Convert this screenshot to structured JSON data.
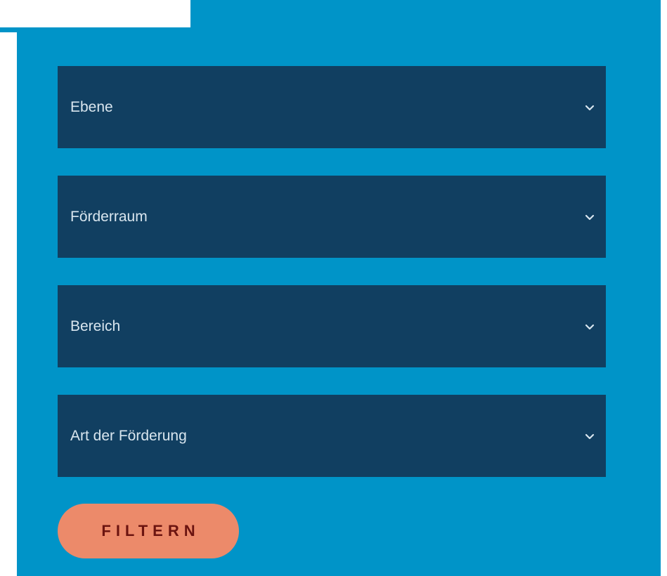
{
  "filters": {
    "selects": [
      {
        "label": "Ebene"
      },
      {
        "label": "Förderraum"
      },
      {
        "label": "Bereich"
      },
      {
        "label": "Art der Förderung"
      }
    ],
    "submit_label": "FILTERN"
  },
  "colors": {
    "panel_background": "#0094c8",
    "select_background": "#113f61",
    "select_text": "#d9e6ef",
    "button_background": "#ec8a6a",
    "button_text": "#6b1410"
  },
  "icons": {
    "select_indicator": "chevron-down-icon"
  }
}
